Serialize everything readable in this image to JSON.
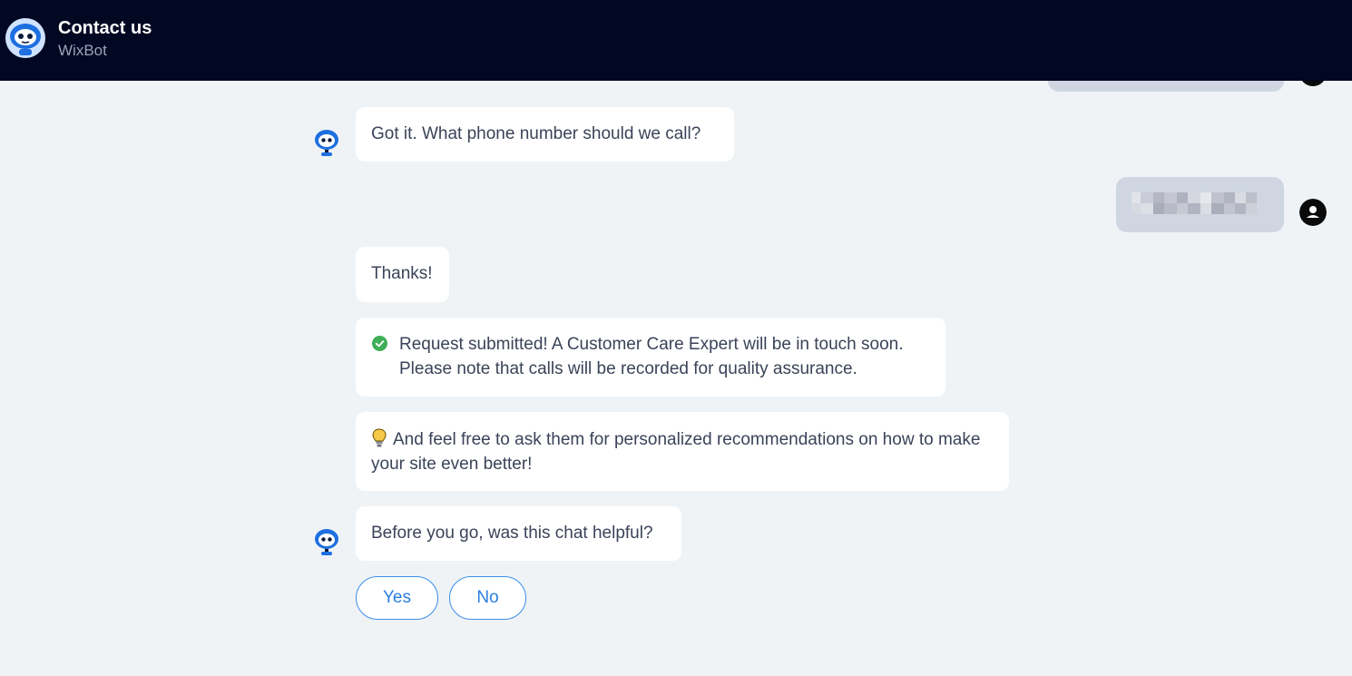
{
  "header": {
    "title": "Contact us",
    "subtitle": "WixBot"
  },
  "messages": {
    "phone_question": "Got it. What phone number should we call?",
    "thanks": "Thanks!",
    "submitted_line1": "Request submitted! A Customer Care Expert will be in touch soon.",
    "submitted_line2": "Please note that calls will be recorded for quality assurance.",
    "tip": "And feel free to ask them for personalized recommendations on how to make your site even better!",
    "feedback_question": "Before you go, was this chat helpful?"
  },
  "feedback": {
    "yes_label": "Yes",
    "no_label": "No"
  },
  "icons": {
    "bot": "wixbot-robot-icon",
    "user": "user-avatar-icon",
    "check": "check-circle-icon",
    "tip": "lightbulb-icon"
  },
  "colors": {
    "header_bg": "#020722",
    "accent": "#2b7fe0",
    "success": "#3fae57"
  }
}
